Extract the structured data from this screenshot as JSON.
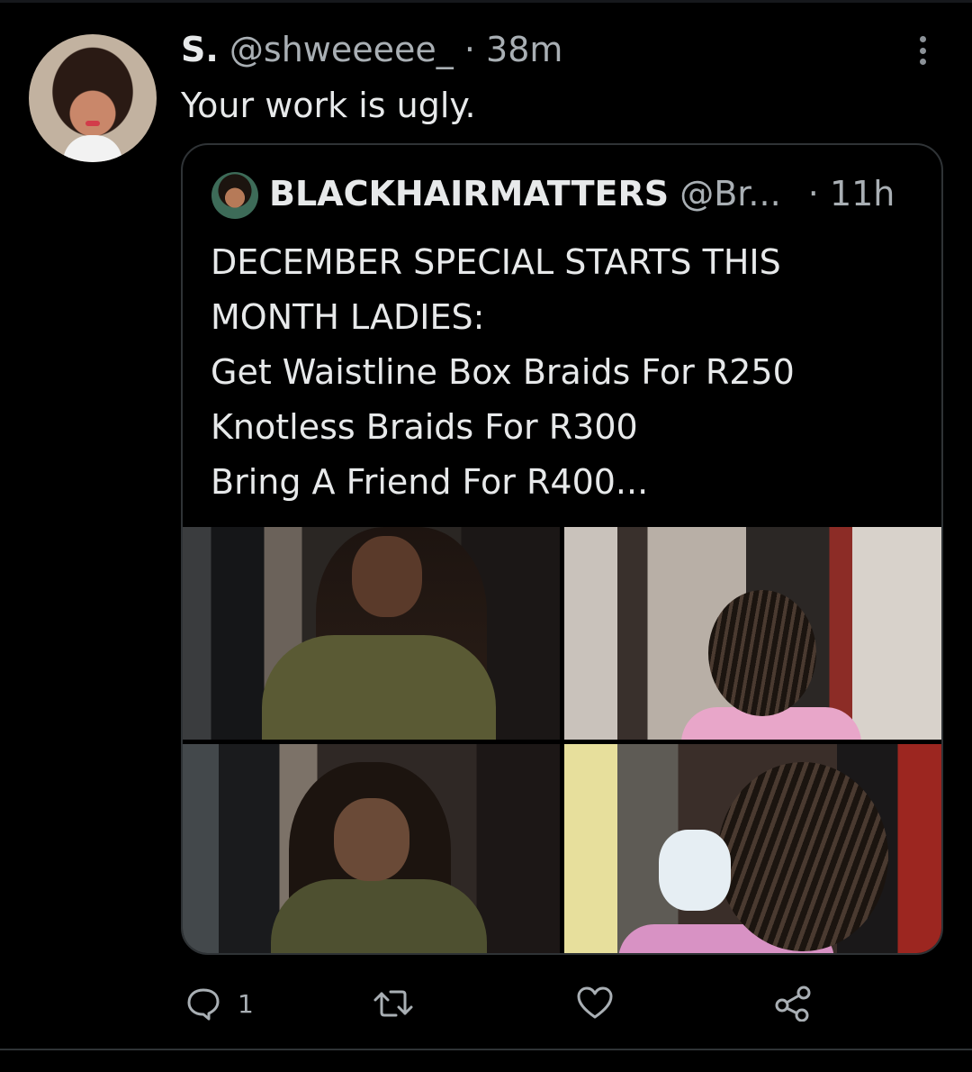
{
  "tweet": {
    "author_name": "S.",
    "handle": "@shweeeee_",
    "separator": "·",
    "time": "38m",
    "text": "Your work is ugly.",
    "reply_count": "1"
  },
  "quoted": {
    "author_name": "BLACKHAIRMATTERS",
    "handle": "@Br...",
    "separator": "·",
    "time": "11h",
    "lines": [
      "DECEMBER SPECIAL STARTS THIS",
      "MONTH LADIES:",
      "Get Waistline Box Braids For R250",
      "Knotless Braids For R300",
      "Bring A Friend For R400..."
    ]
  },
  "icons": [
    "more-icon",
    "reply-icon",
    "retweet-icon",
    "like-icon",
    "share-icon"
  ],
  "colors": {
    "background": "#000000",
    "text": "#e7e9ea",
    "muted": "#a9afb4",
    "border": "#2f3336"
  }
}
